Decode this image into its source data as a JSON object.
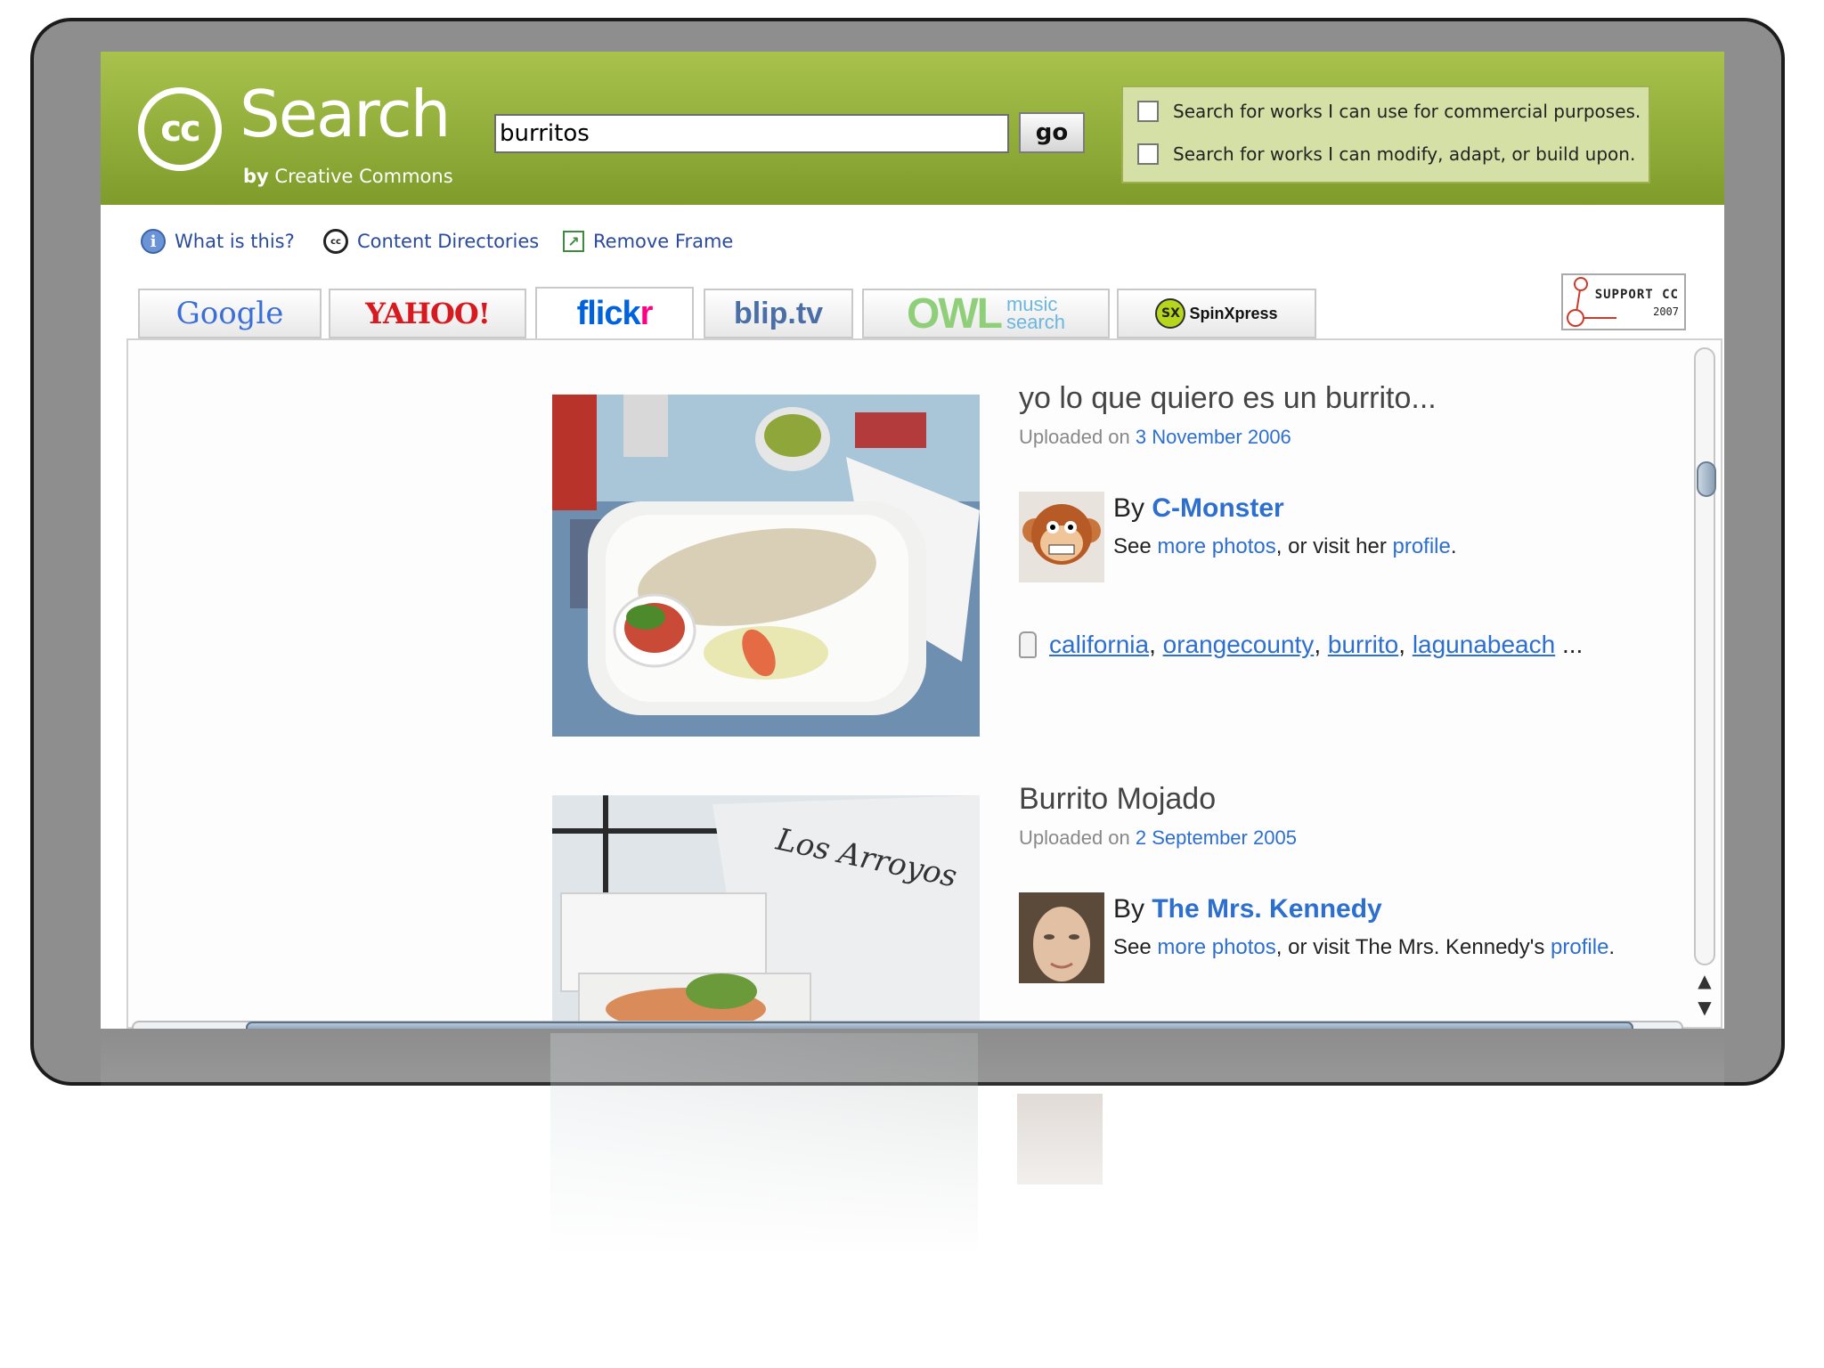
{
  "header": {
    "logo_mark": "cc",
    "logo_word": "Search",
    "logo_by_prefix": "by",
    "logo_by_org": "Creative Commons",
    "search_value": "burritos",
    "go_label": "go",
    "options": [
      "Search for works I can use for commercial purposes.",
      "Search for works I can modify, adapt, or build upon."
    ]
  },
  "links": {
    "what_is_this": "What is this?",
    "content_directories": "Content Directories",
    "remove_frame": "Remove Frame"
  },
  "tabs": {
    "google": "Google",
    "yahoo": "YAHOO!",
    "flickr_a": "flick",
    "flickr_b": "r",
    "blip": "blip.tv",
    "owl": "OWL",
    "owl_sub1": "music",
    "owl_sub2": "search",
    "spin": "SpinXpress",
    "active": "flickr"
  },
  "support": {
    "label": "SUPPORT CC",
    "year": "2007"
  },
  "results": [
    {
      "title": "yo lo que quiero es un burrito...",
      "uploaded_prefix": "Uploaded on",
      "date": "3 November 2006",
      "by": "By",
      "author": "C-Monster",
      "see": "See",
      "more_photos": "more photos",
      "visit": ", or visit her",
      "profile": "profile",
      "period": ".",
      "tags": [
        "california",
        "orangecounty",
        "burrito",
        "lagunabeach"
      ],
      "tags_more": "..."
    },
    {
      "title": "Burrito Mojado",
      "uploaded_prefix": "Uploaded on",
      "date": "2 September 2005",
      "by": "By",
      "author": "The Mrs. Kennedy",
      "see": "See",
      "more_photos": "more photos",
      "visit": ", or visit The Mrs. Kennedy's",
      "profile": "profile",
      "period": "."
    }
  ],
  "colors": {
    "header_green": "#8fae37",
    "link_blue": "#2d6fcf",
    "flickr_blue": "#0063dc",
    "flickr_pink": "#ff0084"
  }
}
